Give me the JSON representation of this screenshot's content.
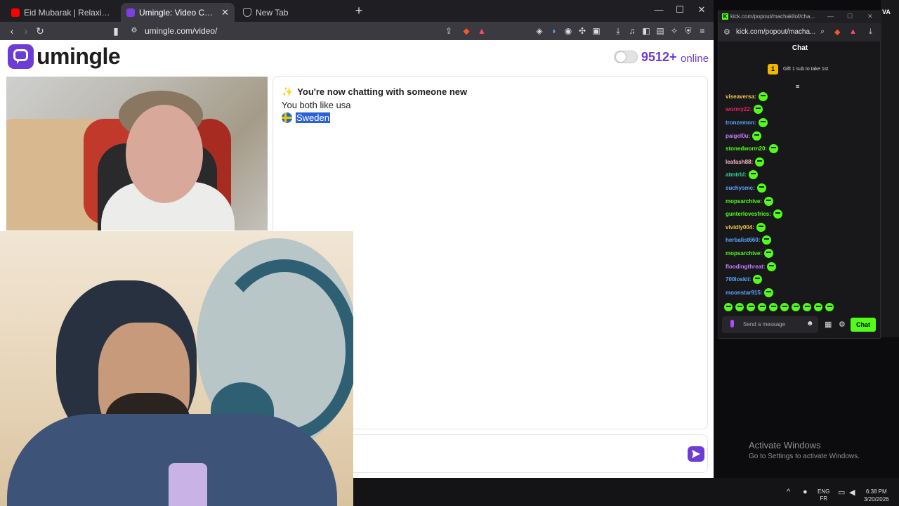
{
  "browser": {
    "tabs": [
      {
        "title": "Eid Mubarak | Relaxing & Beautif",
        "active": false,
        "favicon_color": "#ff0000"
      },
      {
        "title": "Umingle: Video Chat with Str",
        "active": true,
        "favicon_color": "#7b3fe4"
      },
      {
        "title": "New Tab",
        "active": false,
        "favicon_color": "#888888"
      }
    ],
    "url": "umingle.com/video/"
  },
  "site": {
    "logo_text": "umingle",
    "online_count": "9512+",
    "online_label": "online",
    "accent_color": "#6d3bd6"
  },
  "chat": {
    "messages": [
      {
        "icon": "sparkle-icon",
        "text": "You're now chatting with someone new"
      },
      {
        "text": "You both like usa"
      },
      {
        "icon": "sweden-flag-icon",
        "text": "Sweden"
      }
    ],
    "send_icon": "send-icon"
  },
  "kick": {
    "window_title": "kick.com/popout/machakilof/cha...",
    "url": "kick.com/popout/macha...",
    "chat_header": "Chat",
    "gift_badge": "1",
    "gift_text": "Gift 1 sub to take 1st",
    "messages": [
      {
        "user": "viseaversa:",
        "color": "#f2c94c"
      },
      {
        "user": "wormy22:",
        "color": "#e0245e"
      },
      {
        "user": "tronzemon:",
        "color": "#5aa7ff"
      },
      {
        "user": "paigel0u:",
        "color": "#c77dff"
      },
      {
        "user": "stonedworm20:",
        "color": "#53fc18"
      },
      {
        "user": "leafash88:",
        "color": "#ffb4c8"
      },
      {
        "user": "atmtrbl:",
        "color": "#36d399"
      },
      {
        "user": "suchysmc:",
        "color": "#5aa7ff"
      },
      {
        "user": "mopsarchive:",
        "color": "#53fc18"
      },
      {
        "user": "gunterlovesfries:",
        "color": "#53fc18"
      },
      {
        "user": "vividly004:",
        "color": "#f2c94c"
      },
      {
        "user": "herbalist660:",
        "color": "#5aa7ff"
      },
      {
        "user": "mopsarchive:",
        "color": "#53fc18"
      },
      {
        "user": "floodingthreat:",
        "color": "#c77dff"
      },
      {
        "user": "700loskii:",
        "color": "#5aa7ff"
      },
      {
        "user": "moonstar915:",
        "color": "#5aa7ff"
      }
    ],
    "input_placeholder": "Send a message",
    "chat_button": "Chat"
  },
  "os": {
    "activate_title": "Activate Windows",
    "activate_sub": "Go to Settings to activate Windows.",
    "lang_1": "ENG",
    "lang_2": "FR",
    "time": "6:38 PM",
    "date": "3/20/2026"
  }
}
